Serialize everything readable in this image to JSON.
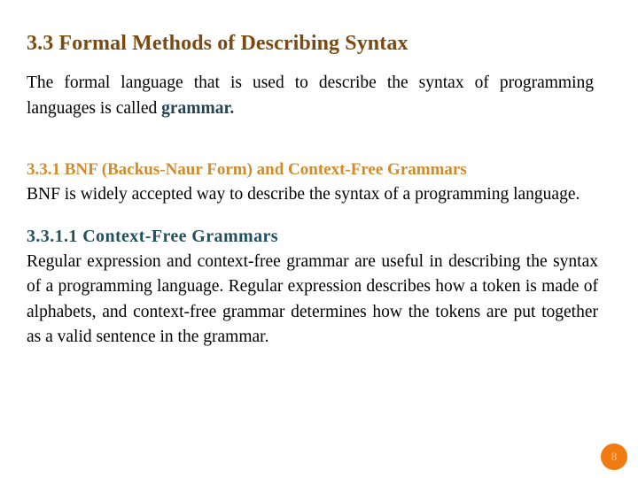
{
  "slide": {
    "title": "3.3 Formal Methods of Describing Syntax",
    "paragraph_1": {
      "text_before": "The formal language that is used to describe the syntax of programming languages is called ",
      "highlight": "grammar.",
      "text_after": ""
    },
    "heading_3_3_1": "3.3.1 BNF (Backus-Naur Form) and Context-Free Grammars",
    "paragraph_2": "BNF is widely accepted way to describe the syntax of a programming language.",
    "heading_3_3_1_1": "3.3.1.1 Context-Free Grammars",
    "paragraph_3": "Regular expression and context-free grammar are useful in describing the syntax of a programming language. Regular expression describes how a token is made of alphabets, and context-free grammar determines how the tokens are put together as a valid sentence in the grammar.",
    "page_number": "8"
  },
  "colors": {
    "title": "#7B4A10",
    "heading_amber": "#D08B2C",
    "heading_teal": "#23505E",
    "highlight_teal": "#1F4552",
    "body_text": "#000000",
    "page_badge_bg": "#F07B10",
    "page_badge_text": "#FDC889",
    "background": "#FFFFFF"
  }
}
